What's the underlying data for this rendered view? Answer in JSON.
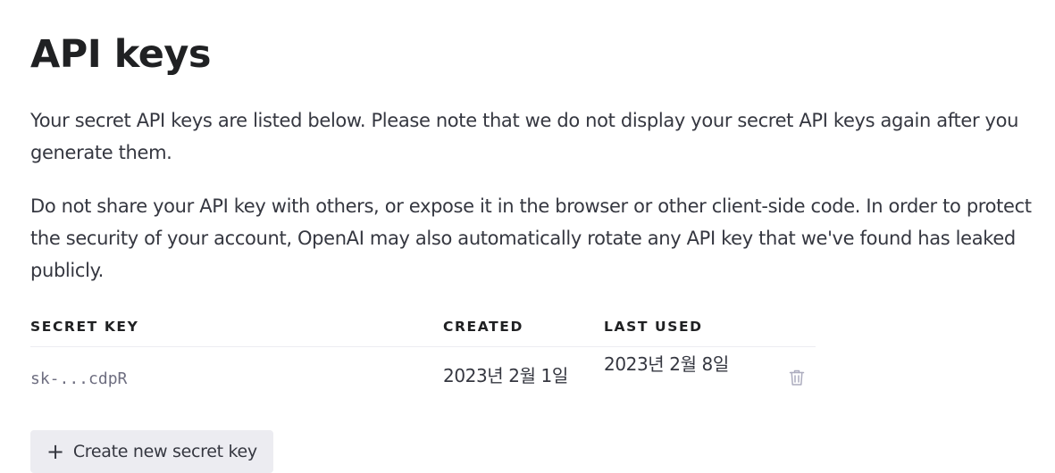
{
  "page": {
    "title": "API keys",
    "description_1": "Your secret API keys are listed below. Please note that we do not display your secret API keys again after you generate them.",
    "description_2": "Do not share your API key with others, or expose it in the browser or other client-side code. In order to protect the security of your account, OpenAI may also automatically rotate any API key that we've found has leaked publicly."
  },
  "table": {
    "headers": {
      "secret_key": "SECRET KEY",
      "created": "CREATED",
      "last_used": "LAST USED"
    },
    "rows": [
      {
        "secret_key": "sk-...cdpR",
        "created": "2023년 2월 1일",
        "last_used": "2023년 2월 8일",
        "delete_icon": "trash-icon"
      }
    ]
  },
  "actions": {
    "create_label": "Create new secret key",
    "create_icon": "plus-icon"
  },
  "colors": {
    "text_primary": "#202123",
    "text_body": "#353740",
    "text_muted": "#6e6e80",
    "button_bg": "#ececf1",
    "divider": "#ececf1",
    "icon_muted": "#acacbe"
  }
}
